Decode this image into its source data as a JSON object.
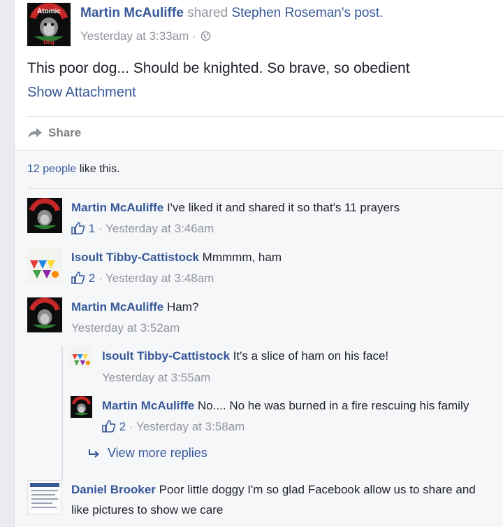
{
  "post": {
    "author": "Martin McAuliffe",
    "shared_text": "shared",
    "original_author": "Stephen Roseman's",
    "original_suffix": "post.",
    "timestamp": "Yesterday at 3:33am",
    "meta_sep": "·",
    "text": "This poor dog... Should be knighted. So brave, so obedient",
    "attachment_link": "Show Attachment",
    "share_label": "Share"
  },
  "likes": {
    "people": "12 people",
    "suffix": "like this."
  },
  "comments": [
    {
      "name": "Martin McAuliffe",
      "text": "I've liked it and shared it so that's 11 prayers",
      "likes": "1",
      "meta": "· Yesterday at 3:46am"
    },
    {
      "name": "Isoult Tibby-Cattistock",
      "text": "Mmmmm, ham",
      "likes": "2",
      "meta": "· Yesterday at 3:48am"
    },
    {
      "name": "Martin McAuliffe",
      "text": "Ham?",
      "meta": "Yesterday at 3:52am"
    }
  ],
  "replies": [
    {
      "name": "Isoult Tibby-Cattistock",
      "text": "It's a slice of ham on his face!",
      "meta": "Yesterday at 3:55am"
    },
    {
      "name": "Martin McAuliffe",
      "text": "No.... No he was burned in a fire rescuing his family",
      "likes": "2",
      "meta": "· Yesterday at 3:58am"
    }
  ],
  "view_more": "View more replies",
  "last_comment": {
    "name": "Daniel Brooker",
    "text": "Poor little doggy I'm so glad Facebook allow us to share and",
    "text2": "like pictures to show we care"
  },
  "avatar_text": {
    "top": "Atomic",
    "bottom": "Dog"
  },
  "colors": {
    "link": "#365899",
    "muted": "#90949c",
    "comment_bg": "#f6f7f9"
  }
}
